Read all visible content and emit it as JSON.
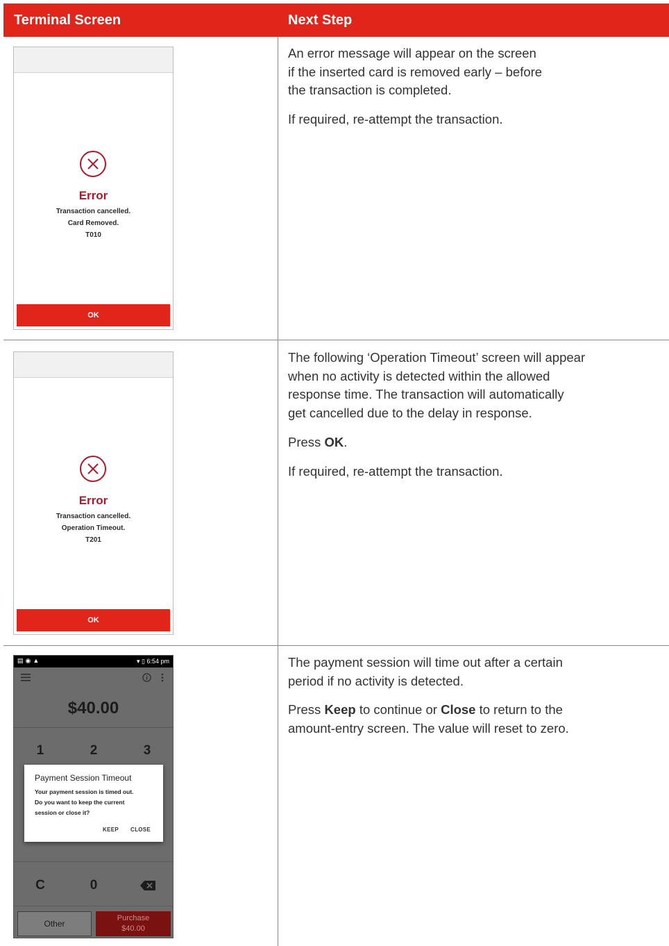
{
  "header": {
    "left_label": "Terminal Screen",
    "right_label": "Next Step",
    "background": "#e1251b"
  },
  "rows": [
    {
      "terminal": {
        "icon": "error-circle-x-icon",
        "title": "Error",
        "lines": [
          "Transaction cancelled.",
          "Card Removed.",
          "T010"
        ],
        "button": "OK"
      },
      "steps": {
        "p1_lines": [
          "An error message will appear on the screen",
          "if the inserted card is removed early – before",
          "the transaction is completed."
        ],
        "p2": "If required, re-attempt the transaction."
      }
    },
    {
      "terminal": {
        "icon": "error-circle-x-icon",
        "title": "Error",
        "lines": [
          "Transaction cancelled.",
          "Operation Timeout.",
          "T201"
        ],
        "button": "OK"
      },
      "steps": {
        "p1_lines": [
          "The following ‘Operation Timeout’ screen will appear",
          "when no activity is detected within the allowed",
          "response time. The transaction will automatically",
          "get cancelled due to the delay in response."
        ],
        "p2_prefix": "Press ",
        "p2_bold": "OK",
        "p2_suffix": ".",
        "p3": "If required, re-attempt the transaction."
      }
    },
    {
      "terminal": {
        "status_time": "6:54 pm",
        "amount": "$40.00",
        "keys": [
          "1",
          "2",
          "3",
          "C",
          "0"
        ],
        "dialog": {
          "title": "Payment Session Timeout",
          "lines": [
            "Your payment session is timed out.",
            "Do you want to keep the current",
            "session or close it?"
          ],
          "keep": "KEEP",
          "close": "CLOSE"
        },
        "other_button": "Other",
        "purchase_label": "Purchase",
        "purchase_amount": "$40.00"
      },
      "steps": {
        "p1_lines": [
          "The payment session will time out after a certain",
          "period if no activity is detected."
        ],
        "p2_prefix": "Press ",
        "p2_keep": "Keep",
        "p2_mid": " to continue or ",
        "p2_close": "Close",
        "p2_suffix": " to return to the",
        "p2_line2": "amount-entry screen. The value will reset to zero."
      }
    }
  ]
}
